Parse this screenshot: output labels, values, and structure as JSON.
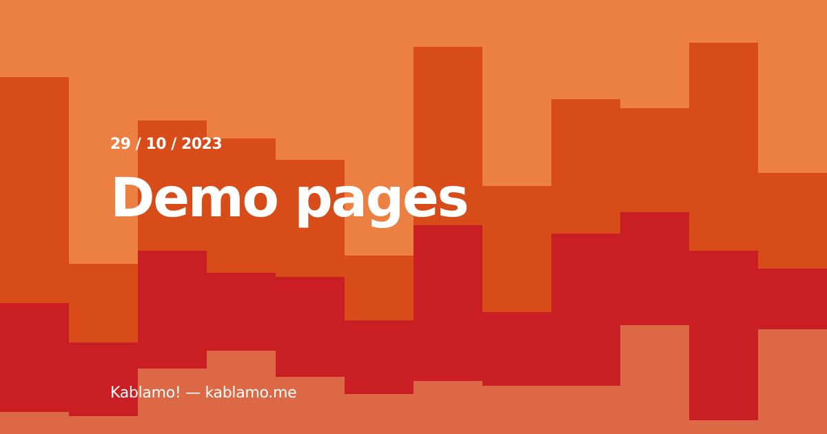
{
  "post": {
    "date": "29 / 10 / 2023",
    "title": "Demo pages",
    "footer": "Kablamo! — kablamo.me"
  },
  "palette": {
    "background": "#ec8043",
    "band_orange": "#d84c19",
    "band_red": "#c91f24",
    "band_salmon": "#dd6845"
  }
}
